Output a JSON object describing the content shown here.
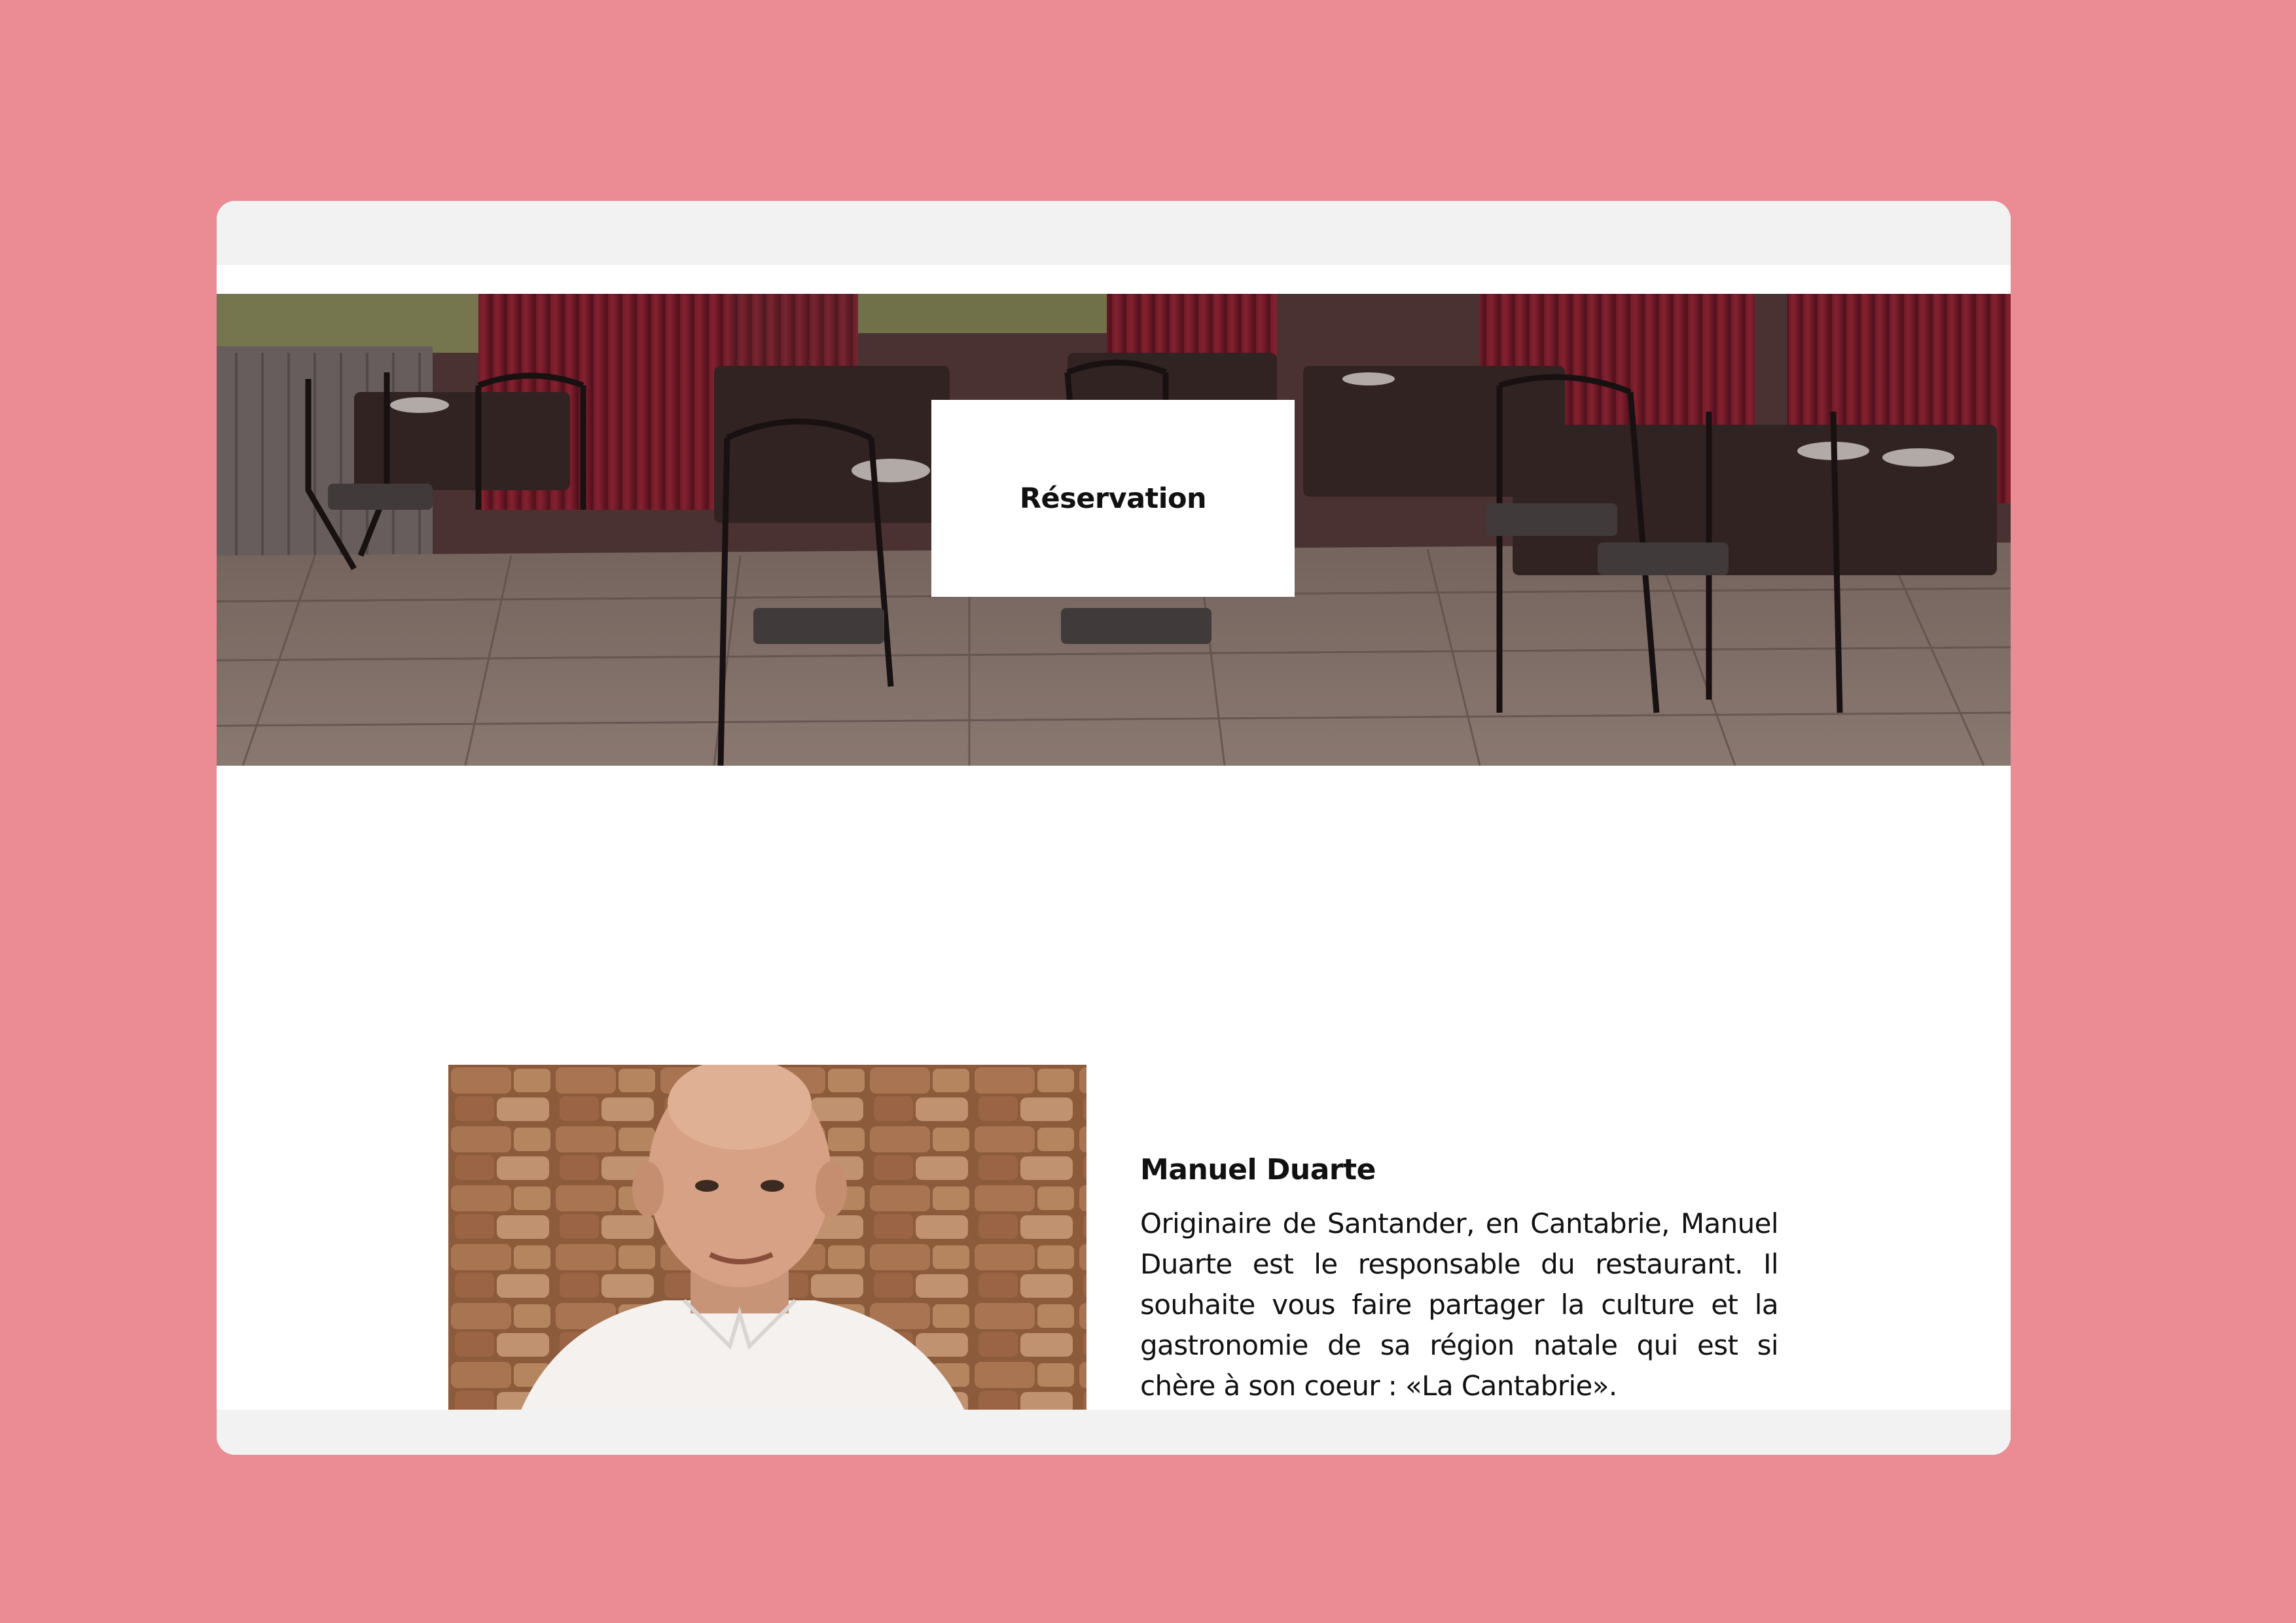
{
  "hero": {
    "button_label": "Réservation"
  },
  "profile": {
    "name": "Manuel Duarte",
    "bio": "Originaire de Santander, en Cantabrie, Manuel Duarte est le responsable du restaurant. Il souhaite vous faire partager la culture et la gastronomie de sa région natale qui est si chère à son coeur : «La Cantabrie»."
  },
  "colors": {
    "page_background": "#eb8c95",
    "window_chrome": "#f2f2f2",
    "window_background": "#ffffff"
  }
}
